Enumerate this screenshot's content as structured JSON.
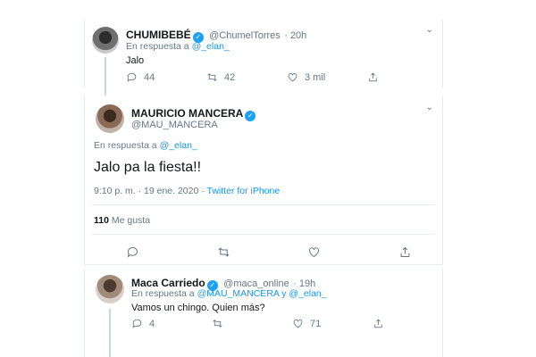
{
  "tweet1": {
    "name": "CHUMIBEBÉ",
    "handle": "@ChumelTorres",
    "time": "· 20h",
    "reply_prefix": "En respuesta a",
    "reply_user": "@_elan_",
    "text": "Jalo",
    "replies": "44",
    "retweets": "42",
    "likes": "3 mil"
  },
  "tweet2": {
    "name": "MAURICIO MANCERA",
    "handle": "@MAU_MANCERA",
    "reply_prefix": "En respuesta a",
    "reply_user": "@_elan_",
    "text": "Jalo pa la fiesta!!",
    "time": "9:10 p. m. · 19 ene. 2020 ·",
    "source": "Twitter for iPhone",
    "likes_count": "110",
    "likes_label": "Me gusta"
  },
  "tweet3": {
    "name": "Maca Carriedo",
    "handle": "@maca_online",
    "time": "· 19h",
    "reply_prefix": "En respuesta a",
    "reply_user1": "@MAU_MANCERA",
    "reply_and": "y",
    "reply_user2": "@_elan_",
    "text": "Vamos un chingo. Quien más?",
    "replies": "4",
    "retweets": "",
    "likes": "71"
  },
  "icons": {
    "verified": "✓",
    "chevron": "⌄"
  },
  "colors": {
    "accent": "#1da1f2",
    "link": "#1b95e0",
    "secondary_text": "#657786",
    "border": "#e6ecf0"
  }
}
